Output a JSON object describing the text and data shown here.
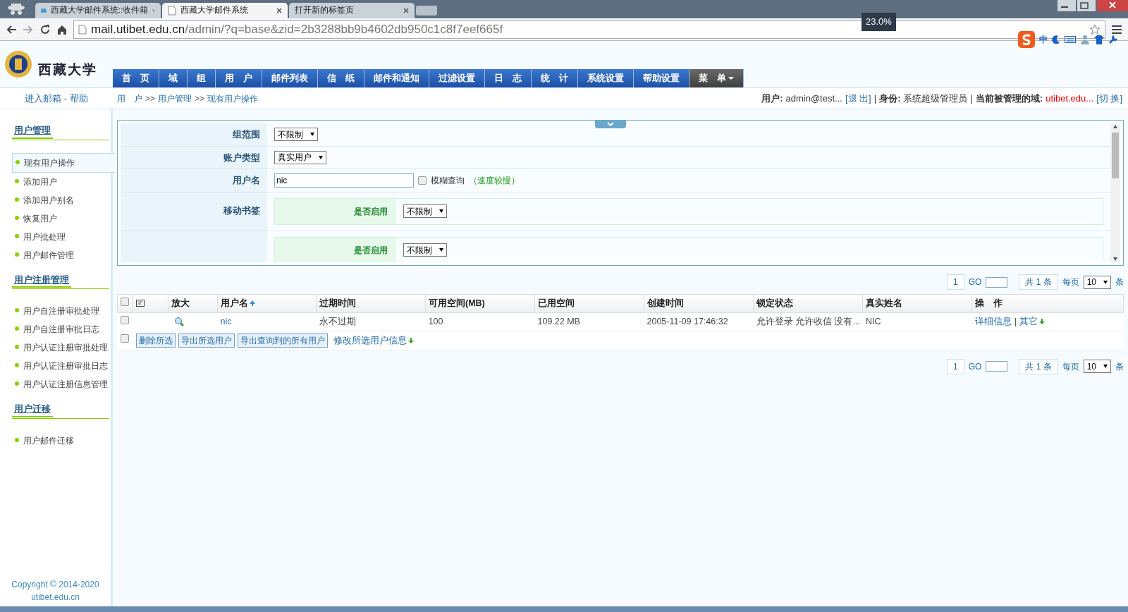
{
  "browser": {
    "tabs": [
      {
        "title": "西藏大学邮件系统::收件箱",
        "selected": false,
        "kind": "mail"
      },
      {
        "title": "西藏大学邮件系统",
        "selected": true,
        "kind": "page"
      },
      {
        "title": "打开新的标签页",
        "selected": false,
        "kind": "blank"
      }
    ],
    "zoom_badge": "23.0%",
    "url_host": "mail.utibet.edu.cn",
    "url_path": "/admin/?q=base&zid=2b3288bb9b4602db950c1c8f7eef665f",
    "ime_label": "中"
  },
  "header": {
    "logo_text": "西藏大学",
    "nav": [
      {
        "label": "首　页",
        "kind": "item"
      },
      {
        "label": "域",
        "kind": "item"
      },
      {
        "label": "组",
        "kind": "item"
      },
      {
        "label": "用　户",
        "kind": "item"
      },
      {
        "label": "邮件列表",
        "kind": "item"
      },
      {
        "label": "信　纸",
        "kind": "item"
      },
      {
        "label": "邮件和通知",
        "kind": "item"
      },
      {
        "label": "过滤设置",
        "kind": "item"
      },
      {
        "label": "日　志",
        "kind": "item"
      },
      {
        "label": "统　计",
        "kind": "item"
      },
      {
        "label": "系统设置",
        "kind": "item"
      },
      {
        "label": "帮助设置",
        "kind": "item"
      },
      {
        "label": "菜　单",
        "kind": "menu"
      }
    ]
  },
  "sidebar": {
    "links": [
      "进入邮箱",
      "帮助"
    ],
    "link_separator": "-",
    "sections": [
      {
        "title": "用户管理",
        "items": [
          {
            "label": "现有用户操作",
            "selected": true
          },
          {
            "label": "添加用户",
            "selected": false
          },
          {
            "label": "添加用户别名",
            "selected": false
          },
          {
            "label": "恢复用户",
            "selected": false
          },
          {
            "label": "用户批处理",
            "selected": false
          },
          {
            "label": "用户邮件管理",
            "selected": false
          }
        ]
      },
      {
        "title": "用户注册管理",
        "items": [
          {
            "label": "用户自注册审批处理",
            "selected": false
          },
          {
            "label": "用户自注册审批日志",
            "selected": false
          },
          {
            "label": "用户认证注册审批处理",
            "selected": false
          },
          {
            "label": "用户认证注册审批日志",
            "selected": false
          },
          {
            "label": "用户认证注册信息管理",
            "selected": false
          }
        ]
      },
      {
        "title": "用户迁移",
        "items": [
          {
            "label": "用户邮件迁移",
            "selected": false
          }
        ]
      }
    ],
    "copyright": [
      "Copyright © 2014-2020",
      "utibet.edu.cn"
    ]
  },
  "breadcrumb": {
    "items": [
      "用　户",
      "用户管理",
      "现有用户操作"
    ],
    "separator": ">>"
  },
  "user_info": [
    {
      "kind": "label",
      "text": "用户:"
    },
    {
      "kind": "text",
      "text": "admin@test..."
    },
    {
      "kind": "link",
      "text": "[退 出]"
    },
    {
      "kind": "sep",
      "text": "|"
    },
    {
      "kind": "label",
      "text": "身份:"
    },
    {
      "kind": "text",
      "text": "系统超级管理员"
    },
    {
      "kind": "sep",
      "text": "|"
    },
    {
      "kind": "label",
      "text": "当前被管理的域:"
    },
    {
      "kind": "domain",
      "text": "utibet.edu..."
    },
    {
      "kind": "link",
      "text": "[切 换]"
    }
  ],
  "filter": {
    "rows": [
      {
        "label": "组范围",
        "kind": "select",
        "value": "不限制"
      },
      {
        "label": "账户类型",
        "kind": "select",
        "value": "真实用户"
      },
      {
        "label": "用户名",
        "kind": "text",
        "value": "nic",
        "checkbox": {
          "label": "模糊查询",
          "checked": false
        },
        "hint": "（速度较慢）"
      },
      {
        "label": "移动书签",
        "kind": "group",
        "sub_label": "是否启用",
        "value": "不限制"
      },
      {
        "kind": "group",
        "sub_label": "是否启用",
        "value": "不限制"
      }
    ]
  },
  "pager": [
    {
      "page": "1",
      "go_label": "GO",
      "total": "共 1 条",
      "per_page_label": "每页",
      "per_page": "10",
      "unit": "条"
    },
    {
      "page": "1",
      "go_label": "GO",
      "total": "共 1 条",
      "per_page_label": "每页",
      "per_page": "10",
      "unit": "条"
    }
  ],
  "table": {
    "select_all_checked": false,
    "action_separator": "|",
    "columns": [
      {
        "kind": "checkbox"
      },
      {
        "kind": "icon"
      },
      {
        "label": "放大",
        "sorted": false
      },
      {
        "label": "用户名",
        "sorted": true
      },
      {
        "label": "过期时间",
        "sorted": false
      },
      {
        "label": "可用空间(MB)",
        "sorted": false
      },
      {
        "label": "已用空间",
        "sorted": false
      },
      {
        "label": "创建时间",
        "sorted": false
      },
      {
        "label": "锁定状态",
        "sorted": false
      },
      {
        "label": "真实姓名",
        "sorted": false
      },
      {
        "label": "操　作",
        "sorted": false
      }
    ],
    "rows": [
      {
        "checked": false,
        "username": "nic",
        "expiry": "永不过期",
        "quota": "100",
        "used": "109.22 MB",
        "created": "2005-11-09 17:46:32",
        "lock_status": "允许登录 允许收信 没有...",
        "real_name": "NIC",
        "actions": [
          "详细信息",
          "其它"
        ]
      }
    ],
    "bulk": {
      "checked": false,
      "buttons": [
        "删除所选",
        "导出所选用户",
        "导出查询到的所有用户"
      ],
      "link": "修改所选用户信息"
    }
  }
}
